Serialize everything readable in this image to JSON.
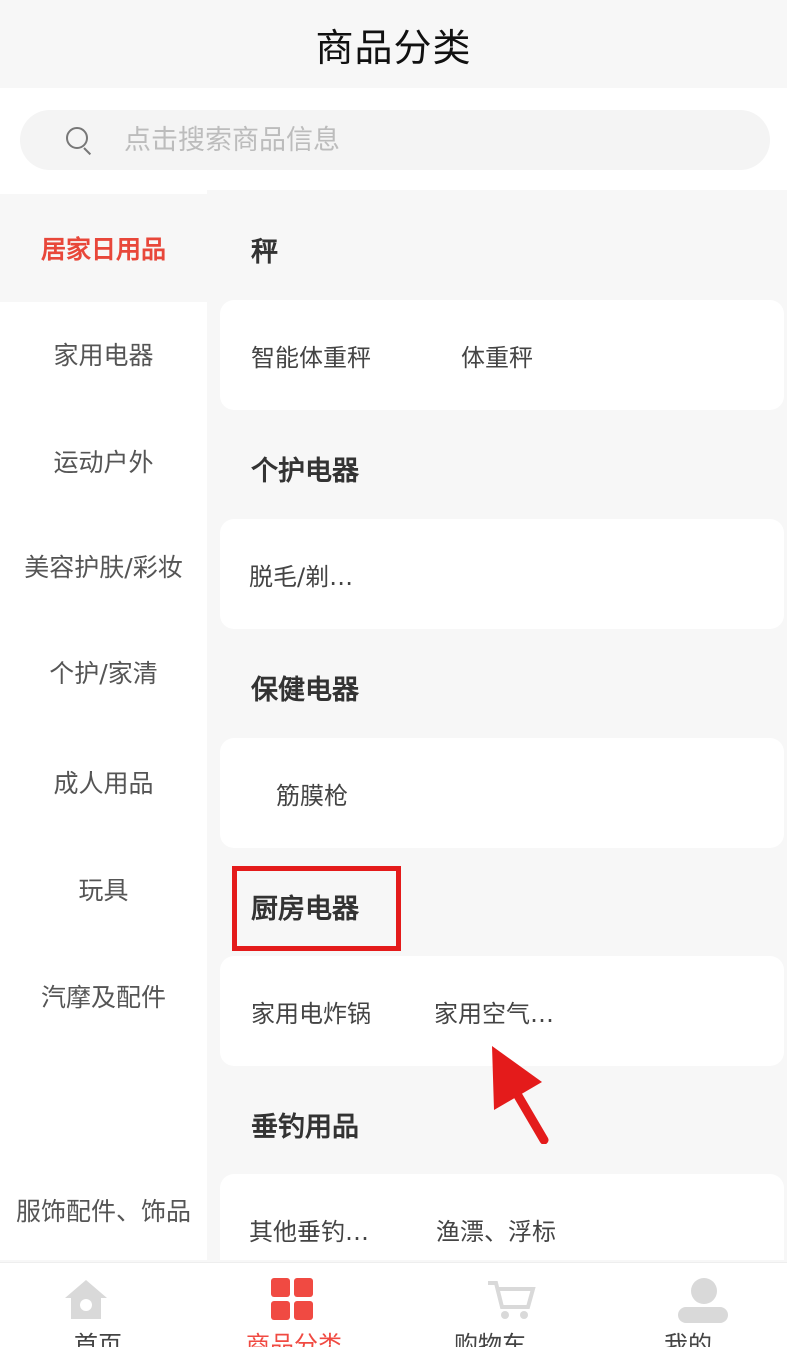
{
  "header": {
    "title": "商品分类"
  },
  "search": {
    "placeholder": "点击搜索商品信息"
  },
  "sidebar": {
    "items": [
      {
        "label": "居家日用品",
        "active": true
      },
      {
        "label": "家用电器"
      },
      {
        "label": "运动户外"
      },
      {
        "label": "美容护肤/彩妆"
      },
      {
        "label": "个护/家清"
      },
      {
        "label": "成人用品"
      },
      {
        "label": "玩具"
      },
      {
        "label": "汽摩及配件"
      },
      {
        "label": "服饰配件、饰品"
      }
    ]
  },
  "content": {
    "sections": [
      {
        "title": "秤",
        "items": [
          "智能体重秤",
          "体重秤"
        ]
      },
      {
        "title": "个护电器",
        "items": [
          "脱毛/剃…"
        ]
      },
      {
        "title": "保健电器",
        "items": [
          "筋膜枪"
        ]
      },
      {
        "title": "厨房电器",
        "items": [
          "家用电炸锅",
          "家用空气…"
        ]
      },
      {
        "title": "垂钓用品",
        "items": [
          "其他垂钓…",
          "渔漂、浮标"
        ]
      }
    ]
  },
  "tabbar": {
    "tabs": [
      {
        "label": "首页",
        "icon": "home-icon"
      },
      {
        "label": "商品分类",
        "icon": "category-icon",
        "active": true
      },
      {
        "label": "购物车",
        "icon": "cart-icon"
      },
      {
        "label": "我的",
        "icon": "user-icon"
      }
    ]
  },
  "colors": {
    "accent": "#e8473a",
    "annotation": "#e41b1b",
    "background": "#f7f7f7"
  }
}
